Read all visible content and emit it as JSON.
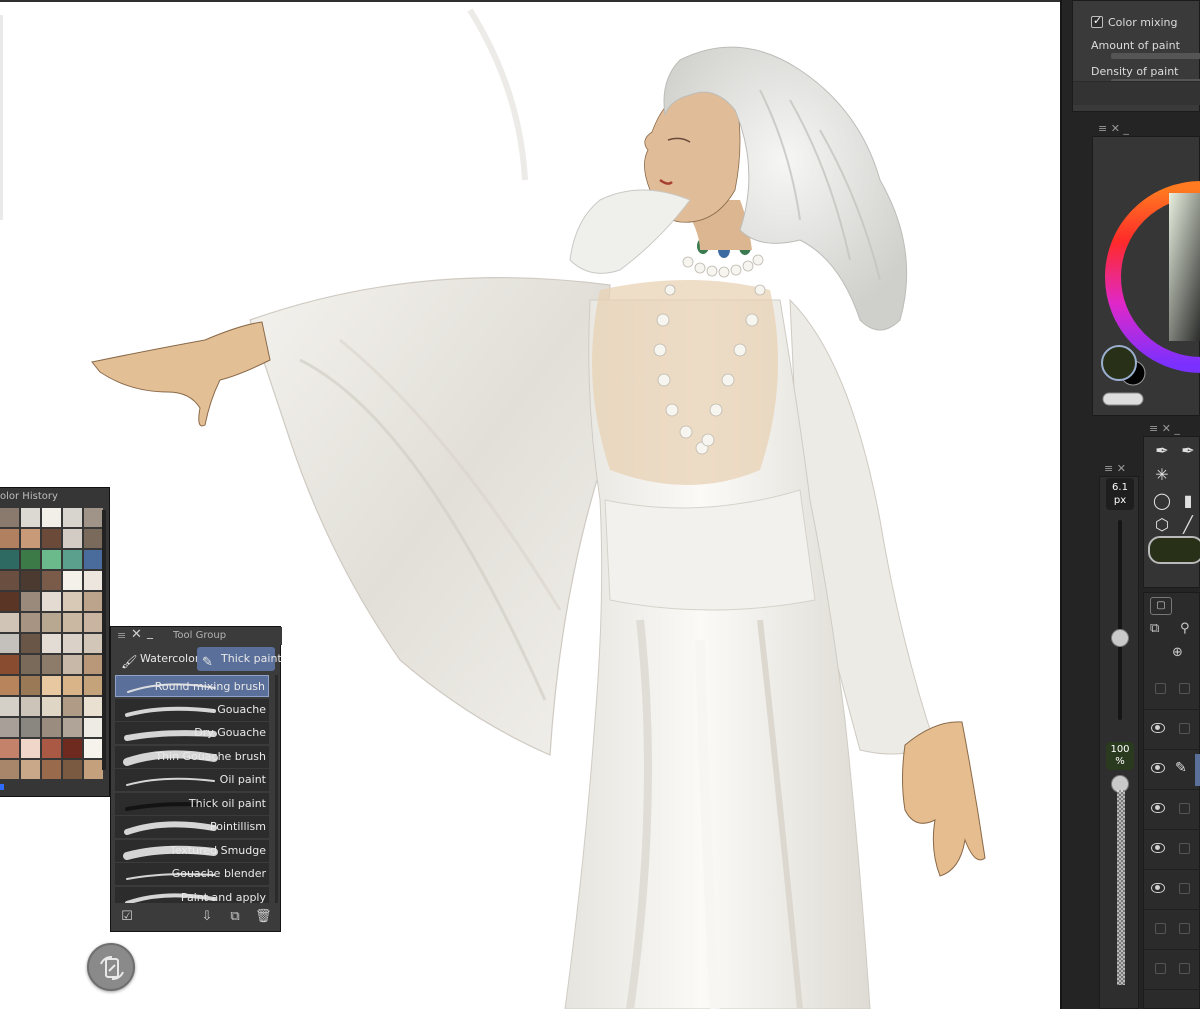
{
  "brush_settings": {
    "color_mixing_label": "Color mixing",
    "color_mixing_checked": true,
    "amount_of_paint_label": "Amount of paint",
    "density_of_paint_label": "Density of paint"
  },
  "color_wheel": {
    "main_color": "#283018",
    "sub_color": "#000000"
  },
  "brush_size": {
    "value": "6.1",
    "unit": "px"
  },
  "brush_opacity": {
    "value": "100",
    "unit": "%"
  },
  "color_history": {
    "title": "olor History",
    "swatches": [
      "#8a7a6e",
      "#dcd8d2",
      "#f2eee8",
      "#d8d4ce",
      "#a09488",
      "#b08060",
      "#c89a78",
      "#6c4a3a",
      "#d2ccc4",
      "#7a6a5c",
      "#2e6a62",
      "#3c7a48",
      "#6aba8c",
      "#5aa08c",
      "#4a6c9c",
      "#6a4e40",
      "#4a3a30",
      "#7a5a48",
      "#f4f0ea",
      "#ece6de",
      "#5a3424",
      "#9a8a7c",
      "#e4dcd2",
      "#d8c8b6",
      "#bca48c",
      "#d0c4b6",
      "#a89482",
      "#b8a892",
      "#cab8a2",
      "#c8b4a0",
      "#c4c0bc",
      "#6a5646",
      "#e2dcd4",
      "#dad2c8",
      "#d2c6b8",
      "#8a4c30",
      "#7a6a5a",
      "#8e7c6a",
      "#c8b8a8",
      "#b89878",
      "#b8845c",
      "#9a7a56",
      "#e8c8a0",
      "#d8b488",
      "#c4a27a",
      "#d4d0c8",
      "#ccc4b8",
      "#e0d6c6",
      "#b09c86",
      "#eae0d2",
      "#a8a098",
      "#8a8680",
      "#9a8c7e",
      "#b0a498",
      "#eeeae4",
      "#c4826a",
      "#f0d6c8",
      "#aa5a44",
      "#6e2a1e",
      "#f6f2ec",
      "#a8866a",
      "#c8a888",
      "#9a6a4c",
      "#7a5a40",
      "#c4a07c"
    ]
  },
  "tool_group": {
    "title": "Tool Group",
    "tabs": [
      "Watercolor",
      "Thick paint"
    ],
    "active_tab": "Thick paint",
    "brushes": [
      "Round mixing brush",
      "Gouache",
      "Dry Gouache",
      "Thin Gouache brush",
      "Oil paint",
      "Thick oil paint",
      "Pointillism",
      "Textured Smudge",
      "Gouache blender",
      "Paint and apply"
    ],
    "selected_brush": "Round mixing brush"
  },
  "icons": {
    "rotate": "rotate-canvas-icon",
    "pen": "pen-icon",
    "eraser": "eraser-icon",
    "eye": "eye-icon"
  },
  "colors": {
    "accent": "#5a6f99",
    "panel": "#3b3b3b",
    "dock": "#242424"
  }
}
